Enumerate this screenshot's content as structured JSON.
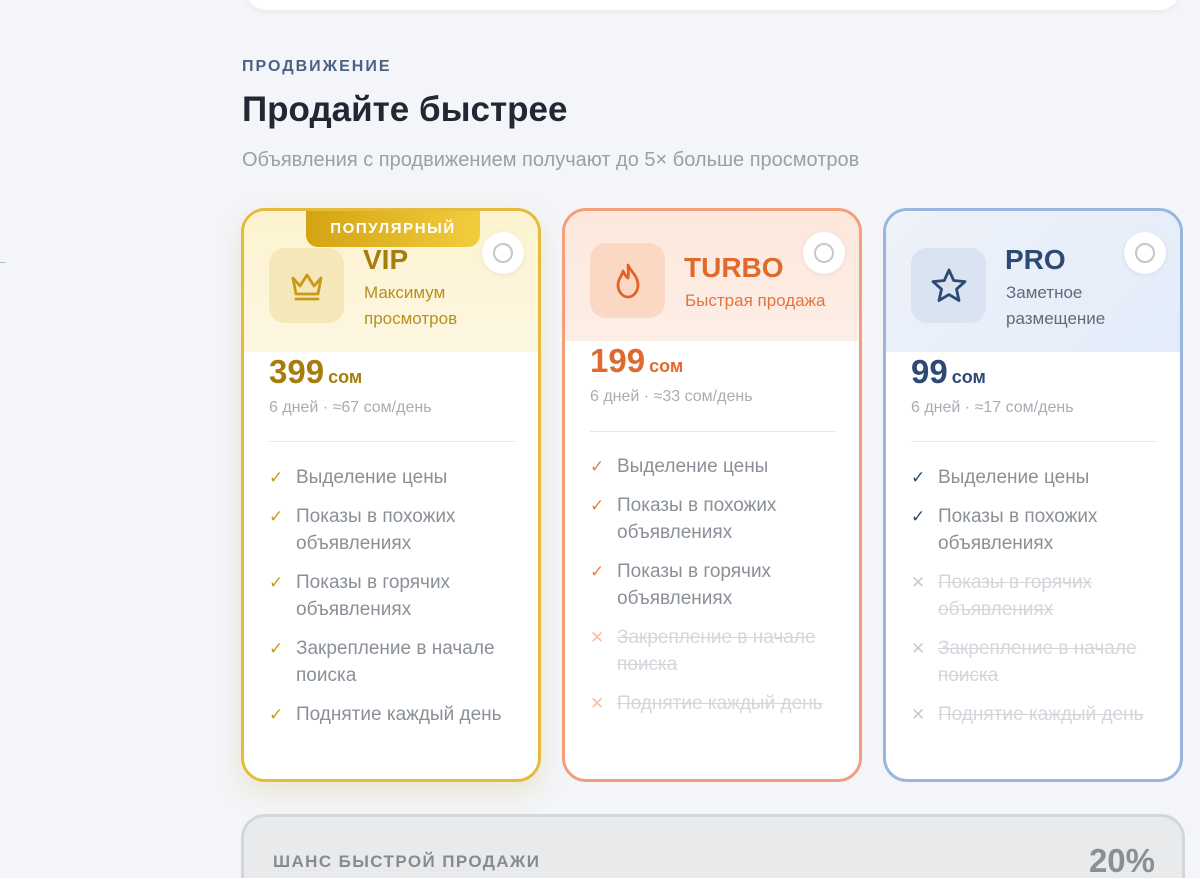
{
  "section": {
    "eyebrow": "ПРОДВИЖЕНИЕ",
    "title": "Продайте быстрее",
    "subtitle": "Объявления с продвижением получают до 5× больше просмотров"
  },
  "colors": {
    "vip_accent": "#c99a17",
    "turbo_accent": "#df6a2c",
    "pro_accent": "#2e4a73"
  },
  "plans": [
    {
      "id": "vip",
      "badge": "ПОПУЛЯРНЫЙ",
      "icon": "crown-icon",
      "name": "VIP",
      "description": "Максимум просмотров",
      "price": "399",
      "currency": "сом",
      "meta": "6 дней · ≈67 сом/день",
      "selected": false,
      "features": [
        {
          "text": "Выделение цены",
          "included": true
        },
        {
          "text": "Показы в похожих объявлениях",
          "included": true
        },
        {
          "text": "Показы в горячих объявлениях",
          "included": true
        },
        {
          "text": "Закрепление в начале поиска",
          "included": true
        },
        {
          "text": "Поднятие каждый день",
          "included": true
        }
      ]
    },
    {
      "id": "turbo",
      "icon": "flame-icon",
      "name": "TURBO",
      "description": "Быстрая продажа",
      "price": "199",
      "currency": "сом",
      "meta": "6 дней · ≈33 сом/день",
      "selected": false,
      "features": [
        {
          "text": "Выделение цены",
          "included": true
        },
        {
          "text": "Показы в похожих объявлениях",
          "included": true
        },
        {
          "text": "Показы в горячих объявлениях",
          "included": true
        },
        {
          "text": "Закрепление в начале поиска",
          "included": false
        },
        {
          "text": "Поднятие каждый день",
          "included": false
        }
      ]
    },
    {
      "id": "pro",
      "icon": "star-icon",
      "name": "PRO",
      "description": "Заметное размещение",
      "price": "99",
      "currency": "сом",
      "meta": "6 дней · ≈17 сом/день",
      "selected": false,
      "features": [
        {
          "text": "Выделение цены",
          "included": true
        },
        {
          "text": "Показы в похожих объявлениях",
          "included": true
        },
        {
          "text": "Показы в горячих объявлениях",
          "included": false
        },
        {
          "text": "Закрепление в начале поиска",
          "included": false
        },
        {
          "text": "Поднятие каждый день",
          "included": false
        }
      ]
    }
  ],
  "chance": {
    "label": "ШАНС БЫСТРОЙ ПРОДАЖИ",
    "value": "20%"
  },
  "marks": {
    "check": "✓",
    "cross": "✕"
  }
}
